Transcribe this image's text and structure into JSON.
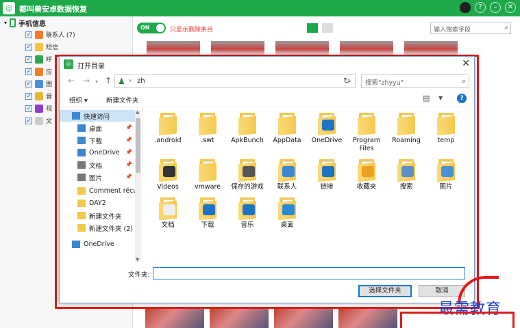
{
  "app": {
    "logo": "◎",
    "title": "都叫兽安卓数据恢复",
    "tree_root": "手机信息",
    "tree_items": [
      {
        "label": "联系人 (7)",
        "color": "#f07b2b"
      },
      {
        "label": "短信",
        "color": "#f5c242"
      },
      {
        "label": "呼",
        "color": "#2ca84a"
      },
      {
        "label": "应",
        "color": "#f07b2b"
      },
      {
        "label": "图",
        "color": "#4a90d9"
      },
      {
        "label": "音",
        "color": "#e8b62b"
      },
      {
        "label": "视",
        "color": "#8b3fc9"
      },
      {
        "label": "文",
        "color": "#cccccc"
      }
    ],
    "toggle_text": "ON",
    "filter_label": "只显示删除条目",
    "search_placeholder": "输入搜索字段"
  },
  "dialog": {
    "title": "打开目录",
    "close": "✕",
    "address": {
      "path": "zh",
      "separator": "›"
    },
    "search_placeholder": "搜索\"zhyyu\"",
    "toolbar": {
      "organize": "组织 ▾",
      "new_folder": "新建文件夹",
      "help": "?"
    },
    "nav_items": [
      {
        "label": "快速访问",
        "icon": "star-icon",
        "color": "#3b87d6",
        "pin": false
      },
      {
        "label": "桌面",
        "icon": "desktop-icon",
        "color": "#3b87d6",
        "pin": true
      },
      {
        "label": "下载",
        "icon": "download-icon",
        "color": "#3b87d6",
        "pin": true
      },
      {
        "label": "OneDrive",
        "icon": "cloud-icon",
        "color": "#3b87d6",
        "pin": true
      },
      {
        "label": "文档",
        "icon": "document-icon",
        "color": "#777777",
        "pin": true
      },
      {
        "label": "图片",
        "icon": "picture-icon",
        "color": "#777777",
        "pin": true
      },
      {
        "label": "Comment récu",
        "icon": "folder-icon",
        "color": "#f2c84b",
        "pin": false
      },
      {
        "label": "DAY2",
        "icon": "folder-icon",
        "color": "#f2c84b",
        "pin": false
      },
      {
        "label": "新建文件夹",
        "icon": "folder-icon",
        "color": "#f2c84b",
        "pin": false
      },
      {
        "label": "新建文件夹 (2)",
        "icon": "folder-icon",
        "color": "#f2c84b",
        "pin": false
      },
      {
        "label": "OneDrive",
        "icon": "cloud-icon",
        "color": "#3b87d6",
        "pin": false
      }
    ],
    "folders": [
      {
        "label": ".android",
        "badge": "",
        "badge_color": ""
      },
      {
        "label": ".swt",
        "badge": "",
        "badge_color": ""
      },
      {
        "label": "ApkBunch",
        "badge": "",
        "badge_color": ""
      },
      {
        "label": "AppData",
        "badge": "",
        "badge_color": ""
      },
      {
        "label": "OneDrive",
        "badge": "cloud",
        "badge_color": "#1d73c4"
      },
      {
        "label": "Program Files",
        "badge": "",
        "badge_color": ""
      },
      {
        "label": "Roaming",
        "badge": "",
        "badge_color": ""
      },
      {
        "label": "temp",
        "badge": "",
        "badge_color": ""
      },
      {
        "label": "Videos",
        "badge": "film",
        "badge_color": "#333333"
      },
      {
        "label": "vmware",
        "badge": "",
        "badge_color": ""
      },
      {
        "label": "保存的游戏",
        "badge": "game",
        "badge_color": "#555555"
      },
      {
        "label": "联系人",
        "badge": "contacts",
        "badge_color": "#3b87d6"
      },
      {
        "label": "链接",
        "badge": "link",
        "badge_color": "#1d73c4"
      },
      {
        "label": "收藏夹",
        "badge": "star",
        "badge_color": "#f0a020"
      },
      {
        "label": "搜索",
        "badge": "search",
        "badge_color": "#5a8fc8"
      },
      {
        "label": "图片",
        "badge": "picture",
        "badge_color": "#4a90d9"
      },
      {
        "label": "文档",
        "badge": "doc",
        "badge_color": "#eeeeee"
      },
      {
        "label": "下载",
        "badge": "download",
        "badge_color": "#1d73c4"
      },
      {
        "label": "音乐",
        "badge": "music",
        "badge_color": "#1d73c4"
      },
      {
        "label": "桌面",
        "badge": "desktop",
        "badge_color": "#2b8ad6"
      }
    ],
    "filename_label": "文件夹:",
    "filename_value": "",
    "select_button": "选择文件夹",
    "cancel_button": "取消"
  },
  "watermark": {
    "text": "最需教育"
  }
}
